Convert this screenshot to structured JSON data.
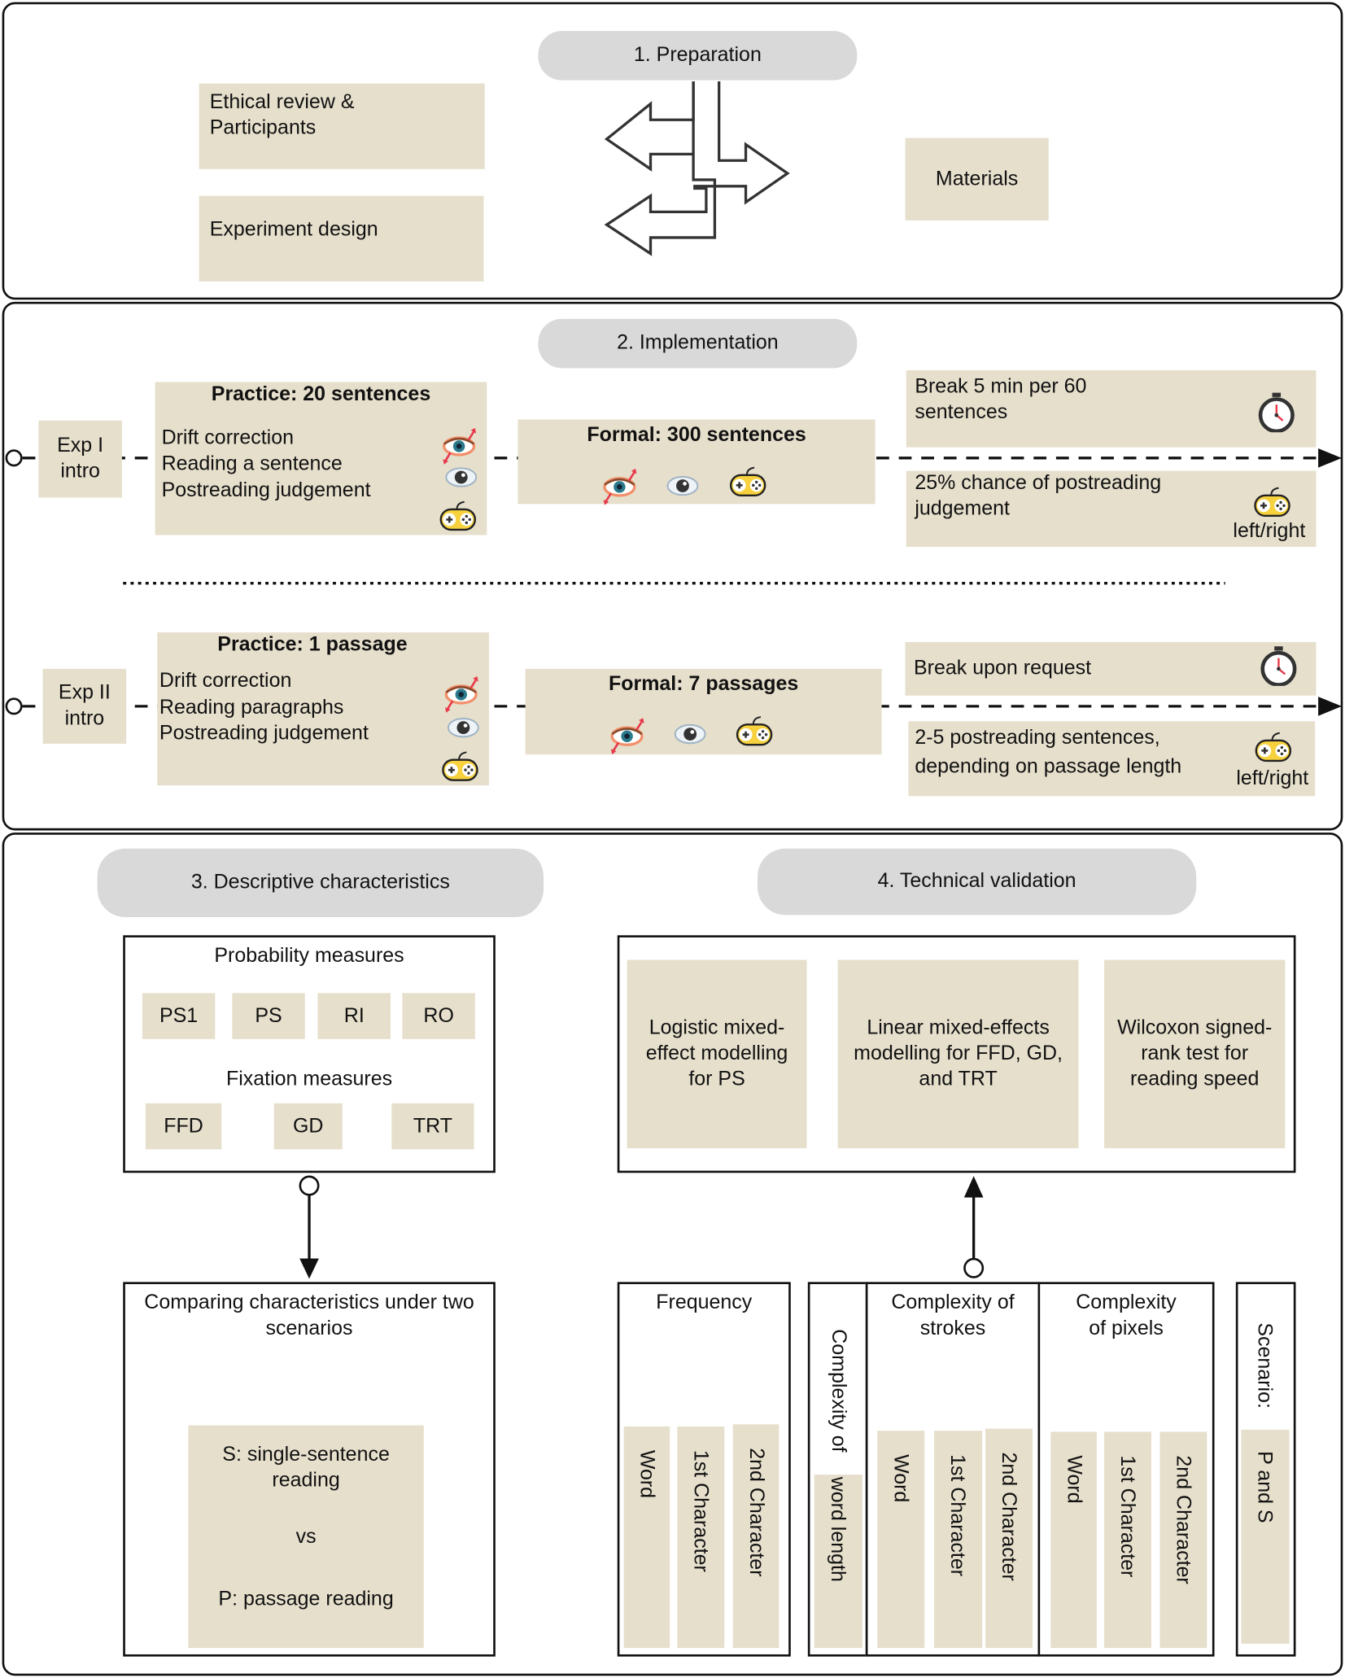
{
  "preparation": {
    "title": "1. Preparation",
    "ethical": "Ethical review & Participants",
    "design": "Experiment design",
    "materials": "Materials"
  },
  "implementation": {
    "title": "2. Implementation",
    "exp1": {
      "intro": "Exp I intro",
      "practice_title": "Practice: 20 sentences",
      "practice_steps": [
        "Drift correction",
        "Reading a sentence",
        "Postreading judgement"
      ],
      "formal_title": "Formal: 300 sentences",
      "break": "Break 5 min per 60 sentences",
      "judgement": "25% chance of postreading judgement",
      "response": "left/right"
    },
    "exp2": {
      "intro": "Exp II intro",
      "practice_title": "Practice: 1 passage",
      "practice_steps": [
        "Drift correction",
        "Reading paragraphs",
        "Postreading judgement"
      ],
      "formal_title": "Formal: 7 passages",
      "break": "Break upon request",
      "judgement": "2-5 postreading sentences, depending on passage length",
      "response": "left/right"
    },
    "icons": [
      "drift-correction-eye-icon",
      "eye-icon",
      "gamepad-icon",
      "stopwatch-icon"
    ],
    "colors": {
      "box": "#e6dfcc",
      "pill": "#d9d9d9",
      "accent_red": "#e8394a",
      "gamepad": "#f7d23e"
    }
  },
  "descriptive": {
    "title": "3. Descriptive characteristics",
    "probability_label": "Probability measures",
    "probability": [
      "PS1",
      "PS",
      "RI",
      "RO"
    ],
    "fixation_label": "Fixation measures",
    "fixation": [
      "FFD",
      "GD",
      "TRT"
    ],
    "compare_title": "Comparing characteristics under two scenarios",
    "scenario_s": "S: single-sentence reading",
    "vs": "vs",
    "scenario_p": "P: passage reading"
  },
  "validation": {
    "title": "4. Technical validation",
    "methods": [
      "Logistic mixed-effect modelling for PS",
      "Linear mixed-effects modelling for FFD, GD, and TRT",
      "Wilcoxon signed-rank test for reading speed"
    ],
    "frequency": {
      "title": "Frequency",
      "items": [
        "Word",
        "1st Character",
        "2nd Character"
      ]
    },
    "word_length": {
      "title": "Complexity of",
      "item": "word length"
    },
    "strokes": {
      "title": "Complexity of strokes",
      "items": [
        "Word",
        "1st Character",
        "2nd Character"
      ]
    },
    "pixels": {
      "title": "Complexity of pixels",
      "items": [
        "Word",
        "1st Character",
        "2nd Character"
      ]
    },
    "scenario": {
      "title": "Scenario:",
      "item": "P and S"
    }
  }
}
